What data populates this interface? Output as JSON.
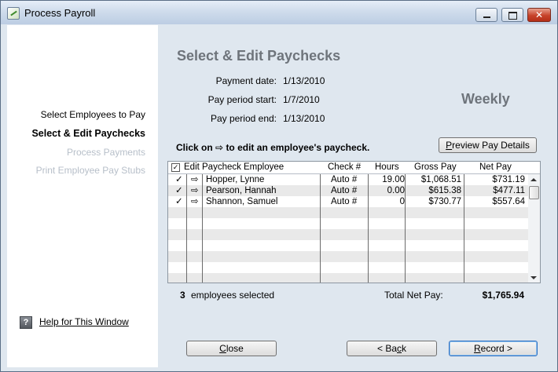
{
  "window": {
    "title": "Process Payroll"
  },
  "steps": [
    {
      "label": "Select Employees to Pay",
      "state": "done"
    },
    {
      "label": "Select & Edit Paychecks",
      "state": "current"
    },
    {
      "label": "Process Payments",
      "state": "pending"
    },
    {
      "label": "Print Employee Pay Stubs",
      "state": "pending"
    }
  ],
  "help": {
    "label": "Help for This Window",
    "icon": "help-icon"
  },
  "header": {
    "title": "Select & Edit Paychecks",
    "payment_date_label": "Payment date:",
    "payment_date": "1/13/2010",
    "period_start_label": "Pay period start:",
    "period_start": "1/7/2010",
    "period_end_label": "Pay period end:",
    "period_end": "1/13/2010",
    "frequency": "Weekly"
  },
  "instruction": {
    "before": "Click on",
    "icon": "arrow-right-icon",
    "after": "to edit an employee's paycheck."
  },
  "buttons": {
    "preview": {
      "pre": "",
      "accel": "P",
      "post": "review Pay Details"
    },
    "close": {
      "pre": "",
      "accel": "C",
      "post": "lose"
    },
    "back": {
      "pre": "< Ba",
      "accel": "c",
      "post": "k"
    },
    "record": {
      "pre": "",
      "accel": "R",
      "post": "ecord >"
    }
  },
  "table": {
    "columns": {
      "check": "",
      "edit": "Edit Paycheck",
      "employee": "Employee",
      "check_no": "Check #",
      "hours": "Hours",
      "gross": "Gross Pay",
      "net": "Net Pay"
    },
    "rows": [
      {
        "selected": "✓",
        "edit_icon": "⇨",
        "employee": "Hopper, Lynne",
        "check_no": "Auto #",
        "hours": "19.00",
        "gross": "$1,068.51",
        "net": "$731.19"
      },
      {
        "selected": "✓",
        "edit_icon": "⇨",
        "employee": "Pearson, Hannah",
        "check_no": "Auto #",
        "hours": "0.00",
        "gross": "$615.38",
        "net": "$477.11"
      },
      {
        "selected": "✓",
        "edit_icon": "⇨",
        "employee": "Shannon, Samuel",
        "check_no": "Auto #",
        "hours": "0",
        "gross": "$730.77",
        "net": "$557.64"
      }
    ]
  },
  "footer": {
    "count": "3",
    "count_label": "employees selected",
    "total_label": "Total Net Pay:",
    "total": "$1,765.94"
  }
}
